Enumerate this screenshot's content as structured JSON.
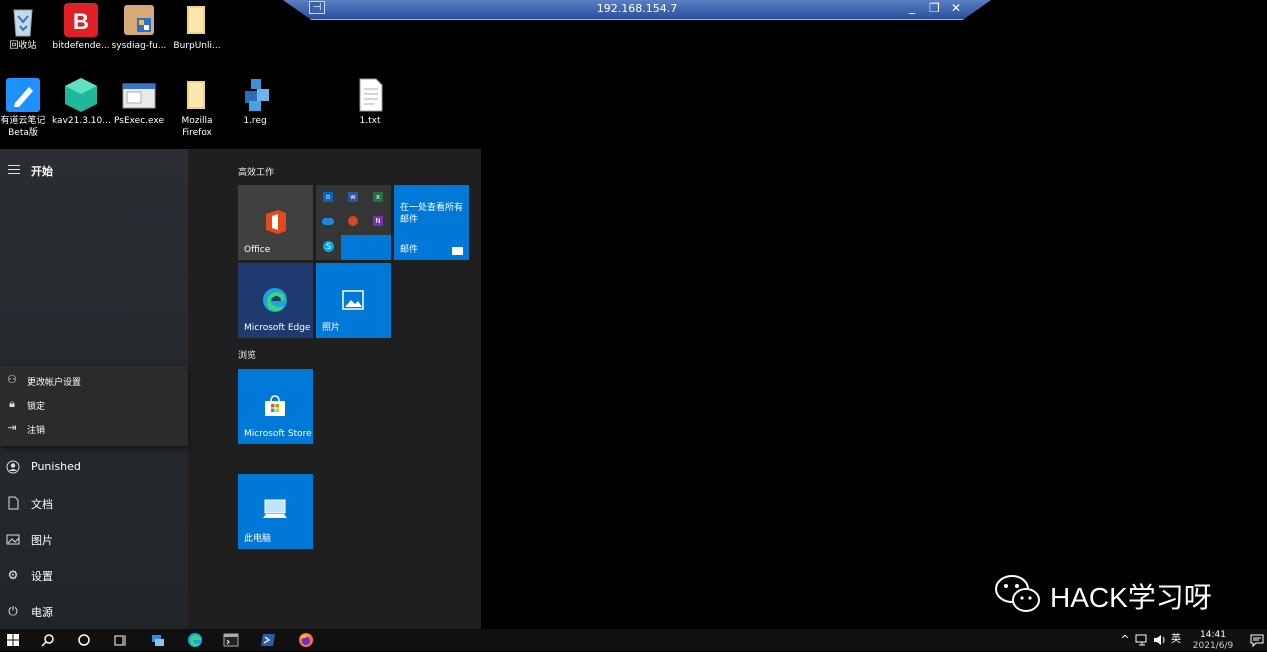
{
  "remote": {
    "ip": "192.168.154.7",
    "pin_glyph": "⊣",
    "min_glyph": "_",
    "restore_glyph": "❐",
    "close_glyph": "✕"
  },
  "desktop": {
    "row1": [
      "回收站",
      "bitdefende...",
      "sysdiag-fu...",
      "BurpUnli..."
    ],
    "row2": [
      [
        "有道云笔记",
        "Beta版"
      ],
      [
        "kav21.3.10...",
        ""
      ],
      [
        "PsExec.exe",
        ""
      ],
      [
        "Mozilla",
        "Firefox"
      ],
      [
        "1.reg",
        ""
      ],
      [
        "1.txt",
        ""
      ]
    ]
  },
  "start": {
    "title": "开始",
    "account_menu": [
      "更改帐户设置",
      "锁定",
      "注销"
    ],
    "user": "Punished",
    "rail": [
      "文档",
      "图片",
      "设置",
      "电源"
    ],
    "group1": "高效工作",
    "group2": "浏览",
    "tiles": {
      "office": "Office",
      "mail_msg": "在一处查看所有邮件",
      "mail": "邮件",
      "edge": "Microsoft Edge",
      "photos": "照片",
      "store": "Microsoft Store",
      "pc": "此电脑"
    }
  },
  "taskbar": {
    "tray": [
      "^",
      "英"
    ],
    "time": "14:41",
    "date": "2021/6/9"
  },
  "watermark": "HACK学习呀",
  "colors": {
    "tile": "#0078d7",
    "office_tile": "#404040",
    "edge_tile": "#1e3a6e",
    "taskbar": "#101010"
  }
}
